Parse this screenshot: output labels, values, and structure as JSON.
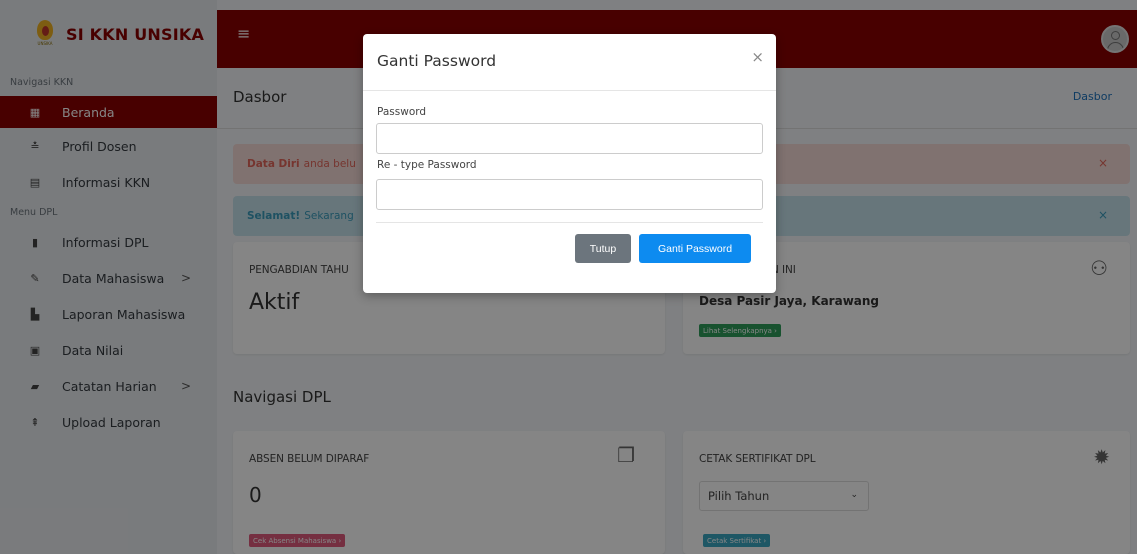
{
  "brand": {
    "name": "SI KKN UNSIKA",
    "logo_text": "UNSIKA"
  },
  "colors": {
    "primary": "#8b0000",
    "accent_blue": "#0d8bf0"
  },
  "sidebar": {
    "header_kkn": "Navigasi KKN",
    "header_dpl": "Menu DPL",
    "items": [
      {
        "label": "Beranda",
        "icon": "dashboard-icon"
      },
      {
        "label": "Profil Dosen",
        "icon": "user-icon"
      },
      {
        "label": "Informasi KKN",
        "icon": "newspaper-icon"
      },
      {
        "label": "Informasi DPL",
        "icon": "book-icon"
      },
      {
        "label": "Data Mahasiswa",
        "icon": "edit-icon",
        "chevron": ">"
      },
      {
        "label": "Laporan Mahasiswa",
        "icon": "file-icon"
      },
      {
        "label": "Data Nilai",
        "icon": "calendar-icon"
      },
      {
        "label": "Catatan Harian",
        "icon": "notebook-icon",
        "chevron": ">"
      },
      {
        "label": "Upload Laporan",
        "icon": "upload-icon"
      }
    ]
  },
  "topbar": {
    "menu_icon": "≡"
  },
  "header": {
    "title": "Dasbor",
    "breadcrumb": "Dasbor"
  },
  "alerts": {
    "danger": {
      "bold": "Data Diri",
      "text": "anda belu",
      "close": "×"
    },
    "info": {
      "bold": "Selamat!",
      "text": "Sekarang",
      "close": "×"
    }
  },
  "cards": {
    "pengabdian": {
      "title": "PENGABDIAN TAHU",
      "value": "Aktif"
    },
    "lokasi": {
      "title": "TAHUN INI",
      "value": "Desa Pasir Jaya, Karawang",
      "button": "Lihat Selengkapnya ›"
    },
    "absen": {
      "title": "ABSEN BELUM DIPARAF",
      "value": "0",
      "button": "Cek Absensi Mahasiswa ›"
    },
    "sertifikat": {
      "title": "CETAK SERTIFIKAT DPL",
      "select_value": "Pilih Tahun",
      "button": "Cetak Sertifikat ›"
    }
  },
  "section": {
    "title": "Navigasi DPL"
  },
  "modal": {
    "title": "Ganti Password",
    "close": "×",
    "password_label": "Password",
    "password_value": "",
    "retype_label": "Re - type Password",
    "retype_value": "",
    "cancel_label": "Tutup",
    "submit_label": "Ganti Password"
  }
}
